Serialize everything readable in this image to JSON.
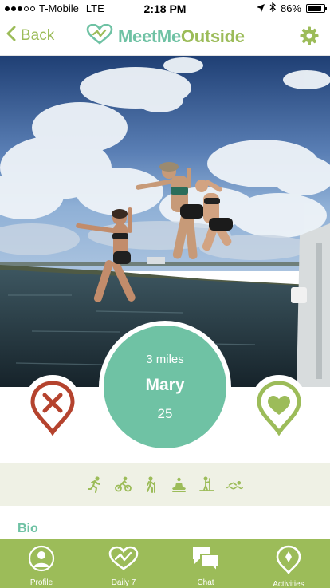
{
  "status_bar": {
    "carrier": "T-Mobile",
    "network": "LTE",
    "time": "2:18 PM",
    "battery": "86%",
    "battery_level": 0.86
  },
  "nav": {
    "back_label": "Back",
    "logo_part1": "MeetMe",
    "logo_part2": "Outside"
  },
  "profile": {
    "distance": "3 miles",
    "name": "Mary",
    "age": "25"
  },
  "activities": [
    "running-icon",
    "cycling-icon",
    "hiking-icon",
    "meditation-icon",
    "paddleboarding-icon",
    "swimming-icon"
  ],
  "bio": {
    "label": "Bio"
  },
  "tabs": [
    {
      "label": "Profile",
      "icon": "person-icon"
    },
    {
      "label": "Daily 7",
      "icon": "daily-heart-icon"
    },
    {
      "label": "Chat",
      "icon": "chat-icon"
    },
    {
      "label": "Activities",
      "icon": "location-pin-icon"
    }
  ],
  "colors": {
    "green": "#9cbc59",
    "teal": "#6fc2a4",
    "red": "#b5432e",
    "strip": "#eff1e5"
  }
}
